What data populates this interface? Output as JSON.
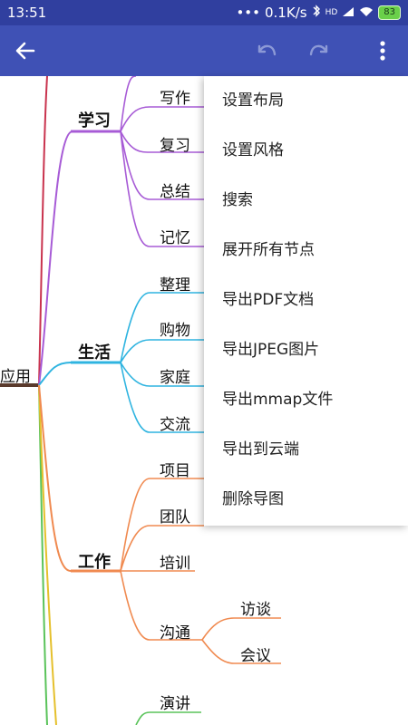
{
  "status_bar": {
    "time": "13:51",
    "network_speed": "0.1K/s",
    "signal_label": "HD",
    "battery": "83"
  },
  "app_bar": {
    "back_icon": "arrow-left-icon",
    "undo_icon": "undo-icon",
    "redo_icon": "redo-icon",
    "more_icon": "more-vert-icon"
  },
  "mindmap": {
    "root_partial": "应用",
    "branches": {
      "study": {
        "label": "学习",
        "color": "#A75BD6",
        "children": [
          "写作",
          "复习",
          "总结",
          "记忆"
        ]
      },
      "life": {
        "label": "生活",
        "color": "#2FB4E0",
        "children": [
          "整理",
          "购物",
          "家庭",
          "交流"
        ]
      },
      "work": {
        "label": "工作",
        "color": "#F08A50",
        "children": [
          "项目",
          "团队",
          "培训",
          "沟通"
        ]
      },
      "communicate_children": [
        "访谈",
        "会议"
      ],
      "bottom_child": "演讲"
    }
  },
  "menu": {
    "items": [
      "设置布局",
      "设置风格",
      "搜索",
      "展开所有节点",
      "导出PDF文档",
      "导出JPEG图片",
      "导出mmap文件",
      "导出到云端",
      "删除导图"
    ]
  },
  "colors": {
    "status_bar": "#303F9F",
    "app_bar": "#3F51B5",
    "root_line": "#5A3A2C",
    "study": "#A75BD6",
    "life": "#2FB4E0",
    "work": "#F08A50",
    "green": "#5AC35A",
    "red": "#C9334E",
    "yellow": "#E5C02C"
  }
}
